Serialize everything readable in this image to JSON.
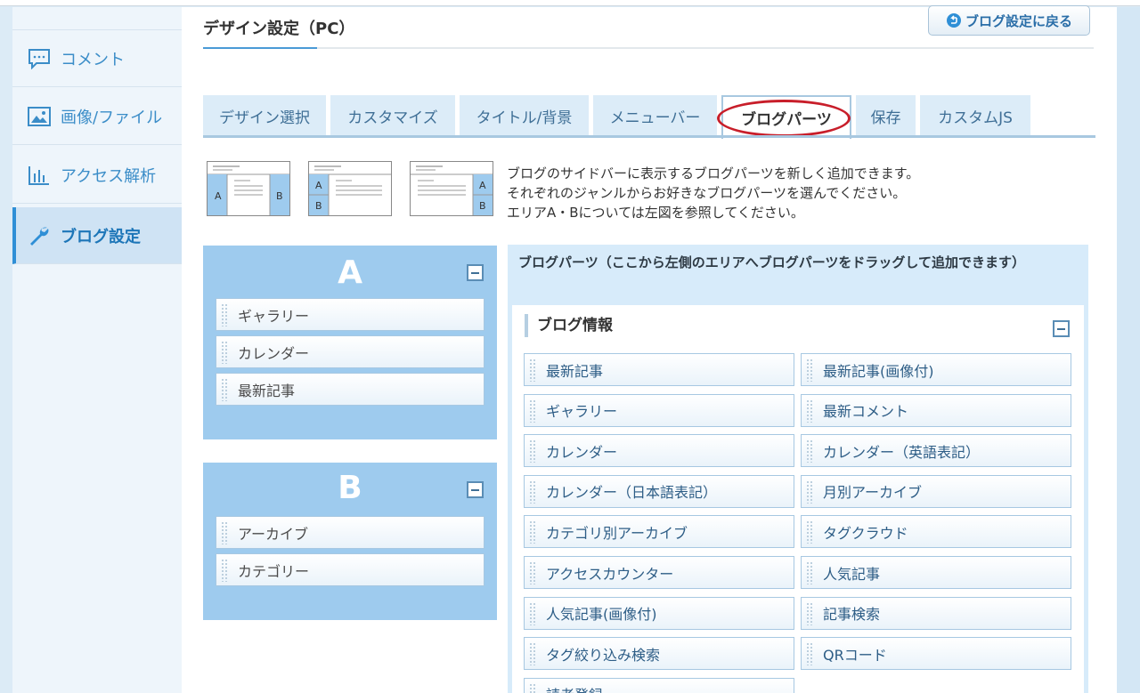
{
  "sidebar": {
    "items": [
      {
        "label": "コメント",
        "icon": "speech-bubble-icon"
      },
      {
        "label": "画像/ファイル",
        "icon": "image-icon"
      },
      {
        "label": "アクセス解析",
        "icon": "bar-chart-icon"
      },
      {
        "label": "ブログ設定",
        "icon": "wrench-icon",
        "active": true
      }
    ]
  },
  "header": {
    "title": "デザイン設定（PC）",
    "back_button": "ブログ設定に戻る"
  },
  "tabs": [
    {
      "label": "デザイン選択"
    },
    {
      "label": "カスタマイズ"
    },
    {
      "label": "タイトル/背景"
    },
    {
      "label": "メニューバー"
    },
    {
      "label": "ブログパーツ",
      "active": true
    },
    {
      "label": "保存"
    },
    {
      "label": "カスタムJS"
    }
  ],
  "description": {
    "line1": "ブログのサイドバーに表示するブログパーツを新しく追加できます。",
    "line2": "それぞれのジャンルからお好きなブログパーツを選んでください。",
    "line3": "エリアA・Bについては左図を参照してください。"
  },
  "layout_icons": {
    "a": "A",
    "b": "B"
  },
  "area_a": {
    "letter": "A",
    "items": [
      "ギャラリー",
      "カレンダー",
      "最新記事"
    ]
  },
  "area_b": {
    "letter": "B",
    "items": [
      "アーカイブ",
      "カテゴリー"
    ]
  },
  "parts_panel": {
    "heading": "ブログパーツ（ここから左側のエリアへブログパーツをドラッグして追加できます）",
    "group_title": "ブログ情報",
    "items": [
      "最新記事",
      "最新記事(画像付)",
      "ギャラリー",
      "最新コメント",
      "カレンダー",
      "カレンダー（英語表記）",
      "カレンダー（日本語表記）",
      "月別アーカイブ",
      "カテゴリ別アーカイブ",
      "タグクラウド",
      "アクセスカウンター",
      "人気記事",
      "人気記事(画像付)",
      "記事検索",
      "タグ絞り込み検索",
      "QRコード",
      "読者登録"
    ]
  },
  "colors": {
    "accent": "#3b8dc8",
    "area_bg": "#9ecbee",
    "panel_bg": "#d7ebfa",
    "highlight_circle": "#c81e2a"
  }
}
